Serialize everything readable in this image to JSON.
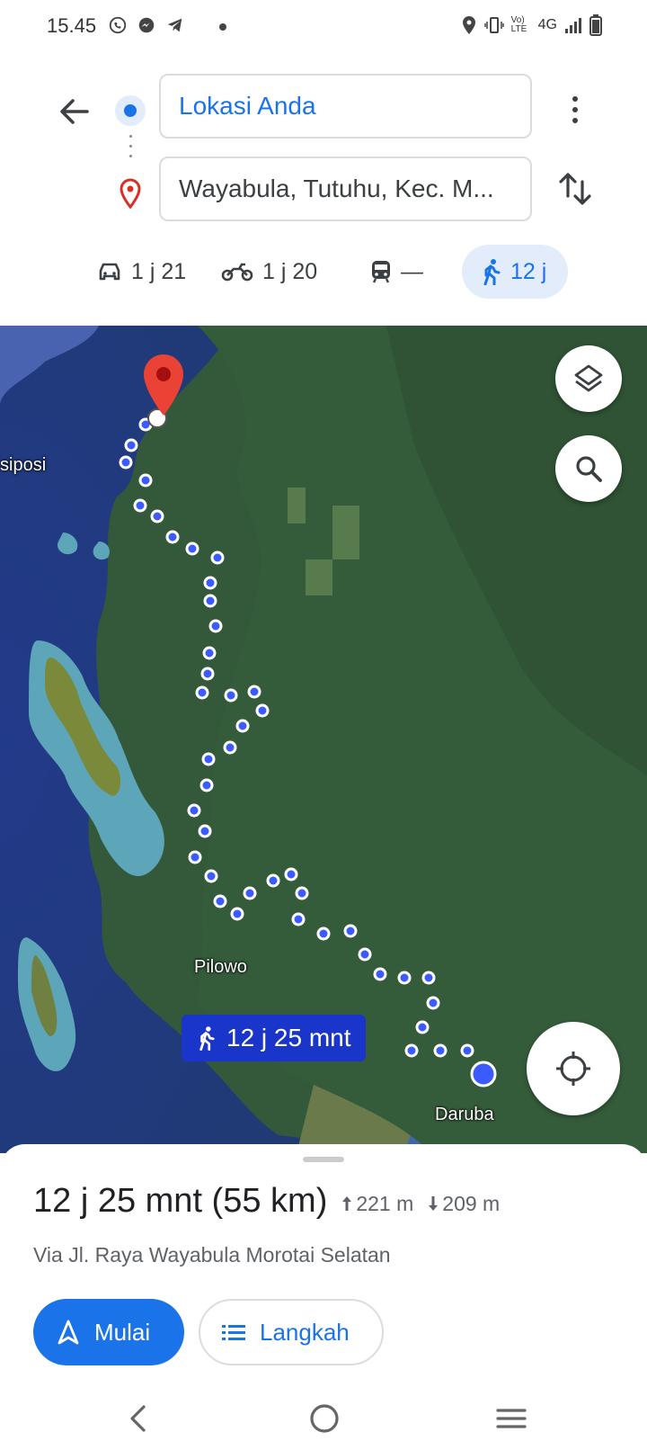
{
  "status_bar": {
    "time": "15.45",
    "network": "4G",
    "volte": "Vo) LTE"
  },
  "directions": {
    "origin": "Lokasi Anda",
    "destination": "Wayabula, Tutuhu, Kec. M..."
  },
  "modes": {
    "car": "1 j 21",
    "motorcycle": "1 j 20",
    "transit": "—",
    "walk": "12 j"
  },
  "map": {
    "labels": {
      "siposi": "siposi",
      "pilowo": "Pilowo",
      "daruba": "Daruba"
    },
    "route_chip": "12 j 25 mnt",
    "route_color": "#3b5bff"
  },
  "summary": {
    "duration_distance": "12 j 25 mnt (55 km)",
    "ascent": "221 m",
    "descent": "209 m",
    "via": "Via Jl. Raya Wayabula Morotai Selatan"
  },
  "buttons": {
    "start": "Mulai",
    "steps": "Langkah"
  },
  "colors": {
    "accent": "#1a73e8",
    "pin": "#d93025"
  }
}
